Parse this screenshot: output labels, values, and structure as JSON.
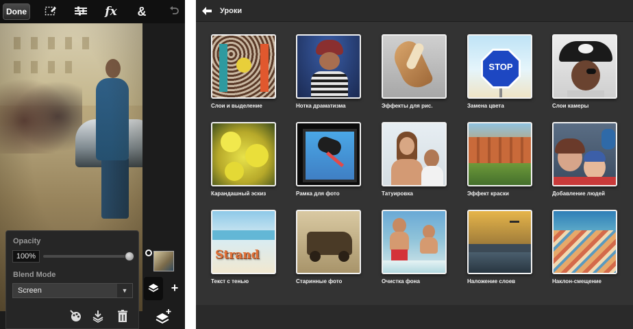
{
  "editor": {
    "toolbar": {
      "done_label": "Done",
      "tools": [
        "selection-icon",
        "adjustments-icon",
        "effects-icon",
        "blend-icon",
        "undo-icon"
      ],
      "effects_label": "fx",
      "blend_label": "&"
    },
    "layer_panel": {
      "opacity_label": "Opacity",
      "opacity_value": "100%",
      "opacity_level": 1.0,
      "blend_mode_label": "Blend Mode",
      "blend_mode_value": "Screen",
      "actions": [
        "adjust-layer-icon",
        "merge-down-icon",
        "trash-icon"
      ]
    },
    "layer_controls": {
      "add_label": "+"
    }
  },
  "tutorials": {
    "title": "Уроки",
    "items": [
      {
        "label": "Слои и выделение"
      },
      {
        "label": "Нотка драматизма"
      },
      {
        "label": "Эффекты для рис."
      },
      {
        "label": "Замена цвета"
      },
      {
        "label": "Слои камеры"
      },
      {
        "label": "Карандашный эскиз"
      },
      {
        "label": "Рамка для фото"
      },
      {
        "label": "Татуировка"
      },
      {
        "label": "Эффект краски"
      },
      {
        "label": "Добавление людей"
      },
      {
        "label": "Текст с тенью"
      },
      {
        "label": "Старинные фото"
      },
      {
        "label": "Очистка фона"
      },
      {
        "label": "Наложение слоев"
      },
      {
        "label": "Наклон-смещение"
      }
    ],
    "stop_sign_text": "STOP",
    "strand_text": "Strand"
  }
}
